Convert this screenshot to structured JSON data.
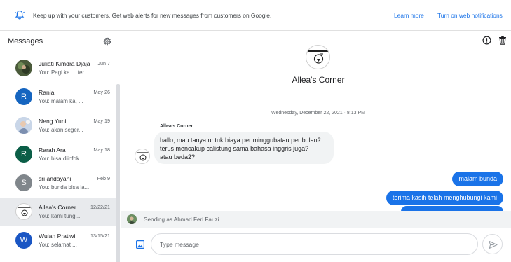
{
  "banner": {
    "text": "Keep up with your customers. Get web alerts for new messages from customers on Google.",
    "learn_more": "Learn more",
    "turn_on": "Turn on web notifications"
  },
  "sidebar": {
    "title": "Messages",
    "conversations": [
      {
        "name": "Juliati Kimdra Djaja",
        "preview": "You: Pagi ka ... ter...",
        "date": "Jun 7",
        "avatar_type": "photo",
        "avatar_color": "#4a5a3a"
      },
      {
        "name": "Rania",
        "preview": "You: malam ka, ...",
        "date": "May 26",
        "avatar_letter": "R",
        "avatar_color": "#1565c0"
      },
      {
        "name": "Neng Yuni",
        "preview": "You: akan seger...",
        "date": "May 19",
        "avatar_type": "photo",
        "avatar_color": "#b0c4de"
      },
      {
        "name": "Rarah Ara",
        "preview": "You: bisa diinfok...",
        "date": "May 18",
        "avatar_letter": "R",
        "avatar_color": "#0b5e47"
      },
      {
        "name": "sri andayani",
        "preview": "You: bunda bisa la...",
        "date": "Feb 9",
        "avatar_letter": "S",
        "avatar_color": "#80868b"
      },
      {
        "name": "Allea's Corner",
        "preview": "You: kami tung...",
        "date": "12/22/21",
        "avatar_type": "logo",
        "avatar_color": "#ffffff",
        "active": true
      },
      {
        "name": "Wulan Pratiwi",
        "preview": "You: selamat ...",
        "date": "13/15/21",
        "avatar_letter": "W",
        "avatar_color": "#1a56c4"
      }
    ]
  },
  "chat": {
    "contact_name": "Allea's Corner",
    "date_separator": "Wednesday, December 22, 2021 · 8:13 PM",
    "sender_label": "Allea's Corner",
    "incoming_lines": [
      "hallo, mau tanya untuk biaya per minggubatau per bulan?",
      "terus mencakup calistung sama bahasa inggris juga?",
      "atau beda2?"
    ],
    "outgoing": [
      "malam bunda",
      "terima kasih telah menghubungi kami"
    ],
    "sending_as": "Sending as Ahmad Feri Fauzi",
    "input_placeholder": "Type message"
  },
  "colors": {
    "accent": "#1a73e8",
    "active_row": "#e8eaed",
    "incoming_bubble": "#f1f3f4"
  },
  "icons": {
    "banner": "bell-icon",
    "settings": "gear-icon",
    "info": "info-icon",
    "delete": "trash-icon",
    "gallery": "image-icon",
    "send": "send-icon"
  }
}
